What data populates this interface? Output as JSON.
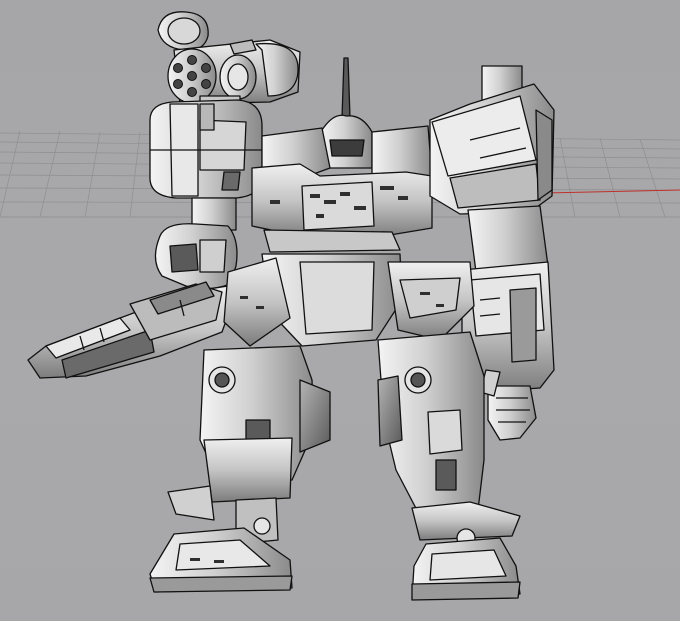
{
  "viewport": {
    "background_color": "#a8a8aa",
    "grid_color": "#8c8c8e",
    "x_axis_color": "#c0302c",
    "model_fill": "#d9d9d9",
    "model_shade": "#8e8e8e",
    "model_dark": "#4a4a4a",
    "model_edge": "#111111",
    "grid_visible": true
  },
  "model": {
    "subject": "mech-robot-3d-model"
  }
}
